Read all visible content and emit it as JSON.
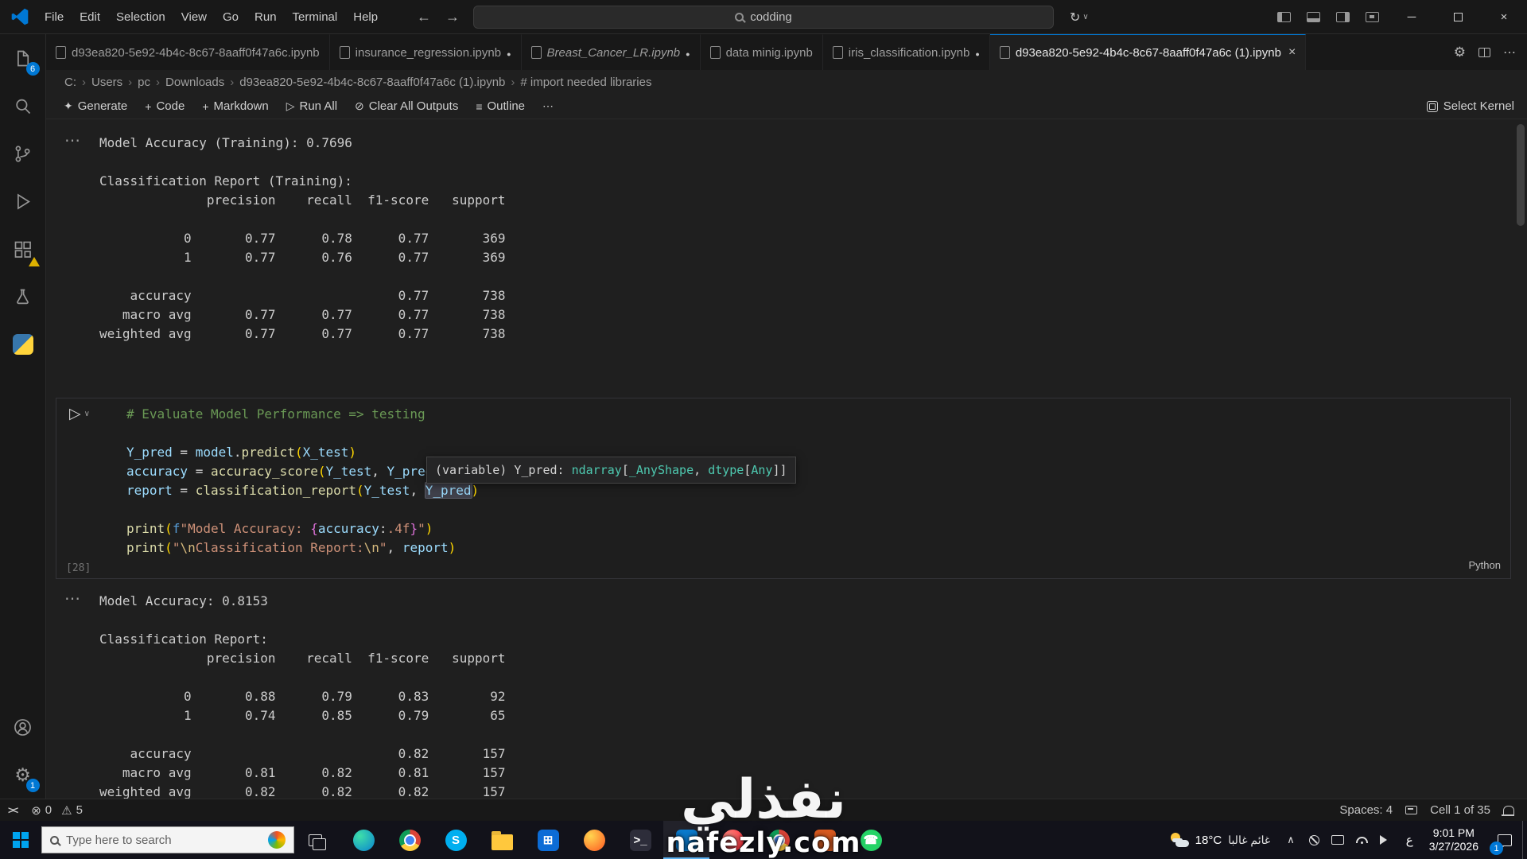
{
  "colors": {
    "accent": "#0078d4",
    "editor_bg": "#1f1f1f",
    "chrome_bg": "#181818",
    "warning_badge": "#ddb100"
  },
  "titlebar": {
    "menus": [
      "File",
      "Edit",
      "Selection",
      "View",
      "Go",
      "Run",
      "Terminal",
      "Help"
    ],
    "search_value": "codding"
  },
  "tabs": [
    {
      "label": "d93ea820-5e92-4b4c-8c67-8aaff0f47a6c.ipynb",
      "modified": false,
      "active": false,
      "italic": false
    },
    {
      "label": "insurance_regression.ipynb",
      "modified": true,
      "active": false,
      "italic": false
    },
    {
      "label": "Breast_Cancer_LR.ipynb",
      "modified": true,
      "active": false,
      "italic": true
    },
    {
      "label": "data minig.ipynb",
      "modified": false,
      "active": false,
      "italic": false
    },
    {
      "label": "iris_classification.ipynb",
      "modified": true,
      "active": false,
      "italic": false
    },
    {
      "label": "d93ea820-5e92-4b4c-8c67-8aaff0f47a6c (1).ipynb",
      "modified": false,
      "active": true,
      "italic": false
    }
  ],
  "breadcrumb": {
    "items": [
      "C:",
      "Users",
      "pc",
      "Downloads",
      "d93ea820-5e92-4b4c-8c67-8aaff0f47a6c (1).ipynb",
      "# import needed libraries"
    ]
  },
  "notebook_toolbar": {
    "buttons": [
      {
        "icon": "sparkle",
        "label": "Generate"
      },
      {
        "icon": "plus",
        "label": "Code"
      },
      {
        "icon": "plus",
        "label": "Markdown"
      },
      {
        "icon": "play",
        "label": "Run All"
      },
      {
        "icon": "clear",
        "label": "Clear All Outputs"
      },
      {
        "icon": "list",
        "label": "Outline"
      },
      {
        "icon": "ellipsis",
        "label": ""
      }
    ],
    "kernel_label": "Select Kernel"
  },
  "activity_bar": {
    "explorer_badge": "6",
    "settings_badge": "1"
  },
  "output_training": {
    "lines": [
      "Model Accuracy (Training): 0.7696",
      "",
      "Classification Report (Training):",
      "              precision    recall  f1-score   support",
      "",
      "           0       0.77      0.78      0.77       369",
      "           1       0.77      0.76      0.77       369",
      "",
      "    accuracy                           0.77       738",
      "   macro avg       0.77      0.77      0.77       738",
      "weighted avg       0.77      0.77      0.77       738"
    ]
  },
  "code_cell": {
    "execution_count": "[28]",
    "language": "Python",
    "lines": [
      [
        {
          "c": "comment",
          "t": "# Evaluate Model Performance => testing"
        }
      ],
      [],
      [
        {
          "c": "var",
          "t": "Y_pred"
        },
        {
          "c": "op",
          "t": " = "
        },
        {
          "c": "var",
          "t": "model"
        },
        {
          "c": "plain",
          "t": "."
        },
        {
          "c": "fn",
          "t": "predict"
        },
        {
          "c": "p1",
          "t": "("
        },
        {
          "c": "var",
          "t": "X_test"
        },
        {
          "c": "p1",
          "t": ")"
        }
      ],
      [
        {
          "c": "var",
          "t": "accuracy"
        },
        {
          "c": "op",
          "t": " = "
        },
        {
          "c": "fn",
          "t": "accuracy_score"
        },
        {
          "c": "p1",
          "t": "("
        },
        {
          "c": "var",
          "t": "Y_test"
        },
        {
          "c": "plain",
          "t": ", "
        },
        {
          "c": "var",
          "t": "Y_pred"
        },
        {
          "c": "p1",
          "t": ")"
        }
      ],
      [
        {
          "c": "var",
          "t": "report"
        },
        {
          "c": "op",
          "t": " = "
        },
        {
          "c": "fn",
          "t": "classification_report"
        },
        {
          "c": "p1",
          "t": "("
        },
        {
          "c": "var",
          "t": "Y_test"
        },
        {
          "c": "plain",
          "t": ", "
        },
        {
          "c": "var hl",
          "t": "Y_pred"
        },
        {
          "c": "p1",
          "t": ")"
        }
      ],
      [],
      [
        {
          "c": "fn",
          "t": "print"
        },
        {
          "c": "p1",
          "t": "("
        },
        {
          "c": "kw",
          "t": "f"
        },
        {
          "c": "str",
          "t": "\"Model Accuracy: "
        },
        {
          "c": "p2",
          "t": "{"
        },
        {
          "c": "var",
          "t": "accuracy"
        },
        {
          "c": "plain",
          "t": ":"
        },
        {
          "c": "str",
          "t": ".4f"
        },
        {
          "c": "p2",
          "t": "}"
        },
        {
          "c": "str",
          "t": "\""
        },
        {
          "c": "p1",
          "t": ")"
        }
      ],
      [
        {
          "c": "fn",
          "t": "print"
        },
        {
          "c": "p1",
          "t": "("
        },
        {
          "c": "str",
          "t": "\""
        },
        {
          "c": "esc",
          "t": "\\n"
        },
        {
          "c": "str",
          "t": "Classification Report:"
        },
        {
          "c": "esc",
          "t": "\\n"
        },
        {
          "c": "str",
          "t": "\""
        },
        {
          "c": "plain",
          "t": ", "
        },
        {
          "c": "var",
          "t": "report"
        },
        {
          "c": "p1",
          "t": ")"
        }
      ]
    ],
    "tooltip": {
      "parts": [
        {
          "c": "plain",
          "t": "(variable) Y_pred: "
        },
        {
          "c": "type",
          "t": "ndarray"
        },
        {
          "c": "plain",
          "t": "["
        },
        {
          "c": "type",
          "t": "_AnyShape"
        },
        {
          "c": "plain",
          "t": ", "
        },
        {
          "c": "type",
          "t": "dtype"
        },
        {
          "c": "plain",
          "t": "["
        },
        {
          "c": "type",
          "t": "Any"
        },
        {
          "c": "plain",
          "t": "]]"
        }
      ]
    }
  },
  "output_testing": {
    "lines": [
      "Model Accuracy: 0.8153",
      "",
      "Classification Report:",
      "              precision    recall  f1-score   support",
      "",
      "           0       0.88      0.79      0.83        92",
      "           1       0.74      0.85      0.79        65",
      "",
      "    accuracy                           0.82       157",
      "   macro avg       0.81      0.82      0.81       157",
      "weighted avg       0.82      0.82      0.82       157"
    ]
  },
  "statusbar": {
    "errors": "0",
    "warnings": "5",
    "spaces": "Spaces: 4",
    "cell_indicator": "Cell 1 of 35"
  },
  "taskbar": {
    "search_placeholder": "Type here to search",
    "apps": [
      {
        "name": "edge",
        "shape": "circle",
        "color": "#0A84D0",
        "color2": "#3EDFA9"
      },
      {
        "name": "chrome",
        "shape": "chrome"
      },
      {
        "name": "skype",
        "shape": "circle",
        "color": "#00AFF0",
        "glyph": "S"
      },
      {
        "name": "file-explorer",
        "shape": "folder",
        "color": "#FFC83D"
      },
      {
        "name": "microsoft-store",
        "shape": "square",
        "color": "#0C6CD6",
        "glyph": "⊞"
      },
      {
        "name": "firefox",
        "shape": "circle",
        "color": "#FF5722",
        "color2": "#FFD54F"
      },
      {
        "name": "terminal",
        "shape": "square",
        "color": "#2D2D3A",
        "glyph": ">_"
      },
      {
        "name": "vscode",
        "shape": "square",
        "color": "#0A7ACC",
        "active": true
      },
      {
        "name": "opera",
        "shape": "circle",
        "color": "#FF1B2D",
        "color2": "#FF8A80"
      },
      {
        "name": "chrome-profile",
        "shape": "chrome"
      },
      {
        "name": "office-app",
        "shape": "square",
        "color": "#D8591F"
      },
      {
        "name": "whatsapp",
        "shape": "circle",
        "color": "#25D366",
        "glyph": "☎"
      }
    ],
    "weather": {
      "temp": "18°C",
      "desc": "غائم غالبا"
    },
    "lang": "ع",
    "time": "9:01 PM",
    "date": "3/27/2026",
    "notification_count": "1"
  },
  "watermark": {
    "title": "نفذلي",
    "domain": "nafezly.com"
  }
}
